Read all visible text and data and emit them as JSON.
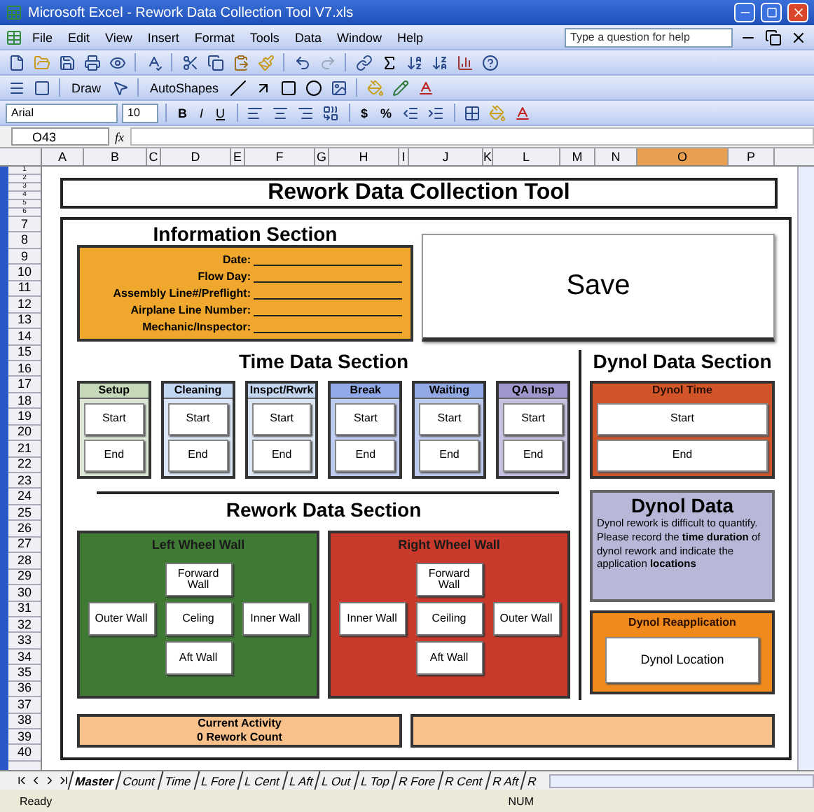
{
  "window": {
    "title": "Microsoft Excel - Rework Data Collection Tool V7.xls"
  },
  "menu": [
    "File",
    "Edit",
    "View",
    "Insert",
    "Format",
    "Tools",
    "Data",
    "Window",
    "Help"
  ],
  "help_search": {
    "placeholder": "Type a question for help"
  },
  "drawing_toolbar": {
    "draw": "Draw",
    "autoshapes": "AutoShapes"
  },
  "formatting_toolbar": {
    "font": "Arial",
    "size": "10",
    "styles": [
      "B",
      "I",
      "U"
    ],
    "number_formats": [
      "$",
      "%"
    ]
  },
  "formula_bar": {
    "name_box": "O43",
    "function_label": "fx"
  },
  "columns": [
    {
      "label": "A",
      "selected": false
    },
    {
      "label": "B",
      "selected": false
    },
    {
      "label": "C",
      "selected": false
    },
    {
      "label": "D",
      "selected": false
    },
    {
      "label": "E",
      "selected": false
    },
    {
      "label": "F",
      "selected": false
    },
    {
      "label": "G",
      "selected": false
    },
    {
      "label": "H",
      "selected": false
    },
    {
      "label": "I",
      "selected": false
    },
    {
      "label": "J",
      "selected": false
    },
    {
      "label": "K",
      "selected": false
    },
    {
      "label": "L",
      "selected": false
    },
    {
      "label": "M",
      "selected": false
    },
    {
      "label": "N",
      "selected": false
    },
    {
      "label": "O",
      "selected": true
    },
    {
      "label": "P",
      "selected": false
    }
  ],
  "rows": [
    "1",
    "2",
    "3",
    "4",
    "5",
    "6",
    "7",
    "8",
    "9",
    "10",
    "11",
    "12",
    "13",
    "14",
    "15",
    "16",
    "17",
    "18",
    "19",
    "20",
    "21",
    "22",
    "23",
    "24",
    "25",
    "26",
    "27",
    "28",
    "29",
    "30",
    "31",
    "32",
    "33",
    "34",
    "35",
    "36",
    "37",
    "38",
    "39",
    "40"
  ],
  "sheet": {
    "title": "Rework Data Collection Tool",
    "information_section": {
      "heading": "Information Section",
      "fields": [
        "Date:",
        "Flow Day:",
        "Assembly Line#/Preflight:",
        "Airplane Line Number:",
        "Mechanic/Inspector:"
      ]
    },
    "save_button": "Save",
    "time_section": {
      "heading": "Time Data Section",
      "activities": [
        {
          "label": "Setup",
          "color": "#c5d8b9",
          "start": "Start",
          "end": "End"
        },
        {
          "label": "Cleaning",
          "color": "#c3d7f2",
          "start": "Start",
          "end": "End"
        },
        {
          "label": "Inspct/Rwrk",
          "color": "#c3d5ef",
          "start": "Start",
          "end": "End"
        },
        {
          "label": "Break",
          "color": "#93aaea",
          "start": "Start",
          "end": "End"
        },
        {
          "label": "Waiting",
          "color": "#93a9e6",
          "start": "Start",
          "end": "End"
        },
        {
          "label": "QA Insp",
          "color": "#a196cc",
          "start": "Start",
          "end": "End"
        }
      ]
    },
    "rework_section": {
      "heading": "Rework Data Section",
      "panels": [
        {
          "title": "Left Wheel Wall",
          "color": "#3f7a35",
          "walls": [
            "Forward Wall",
            "Outer Wall",
            "Celing",
            "Inner Wall",
            "Aft Wall"
          ]
        },
        {
          "title": "Right Wheel Wall",
          "color": "#c93a2c",
          "walls": [
            "Forward Wall",
            "Inner Wall",
            "Ceiling",
            "Outer Wall",
            "Aft Wall"
          ]
        }
      ]
    },
    "dynol_section": {
      "heading": "Dynol Data Section",
      "timer": {
        "title": "Dynol Time",
        "start": "Start",
        "end": "End"
      },
      "info": {
        "title": "Dynol Data",
        "text": "Dynol rework is difficult to quantify.  Please record the **time duration** of dynol rework and indicate the application **locations**"
      },
      "reapplication": {
        "title": "Dynol Reapplication",
        "button": "Dynol Location"
      }
    },
    "current_activity": {
      "title": "Current Activity",
      "count": "0 Rework Count"
    }
  },
  "sheet_tabs": [
    {
      "label": "Master",
      "selected": true
    },
    {
      "label": "Count",
      "selected": false
    },
    {
      "label": "Time",
      "selected": false
    },
    {
      "label": "L Fore",
      "selected": false
    },
    {
      "label": "L Cent",
      "selected": false
    },
    {
      "label": "L Aft",
      "selected": false
    },
    {
      "label": "L Out",
      "selected": false
    },
    {
      "label": "L Top",
      "selected": false
    },
    {
      "label": "R Fore",
      "selected": false
    },
    {
      "label": "R Cent",
      "selected": false
    },
    {
      "label": "R Aft",
      "selected": false
    },
    {
      "label": "R",
      "selected": false
    }
  ],
  "status_bar": {
    "mode": "Ready",
    "indicator": "NUM"
  }
}
